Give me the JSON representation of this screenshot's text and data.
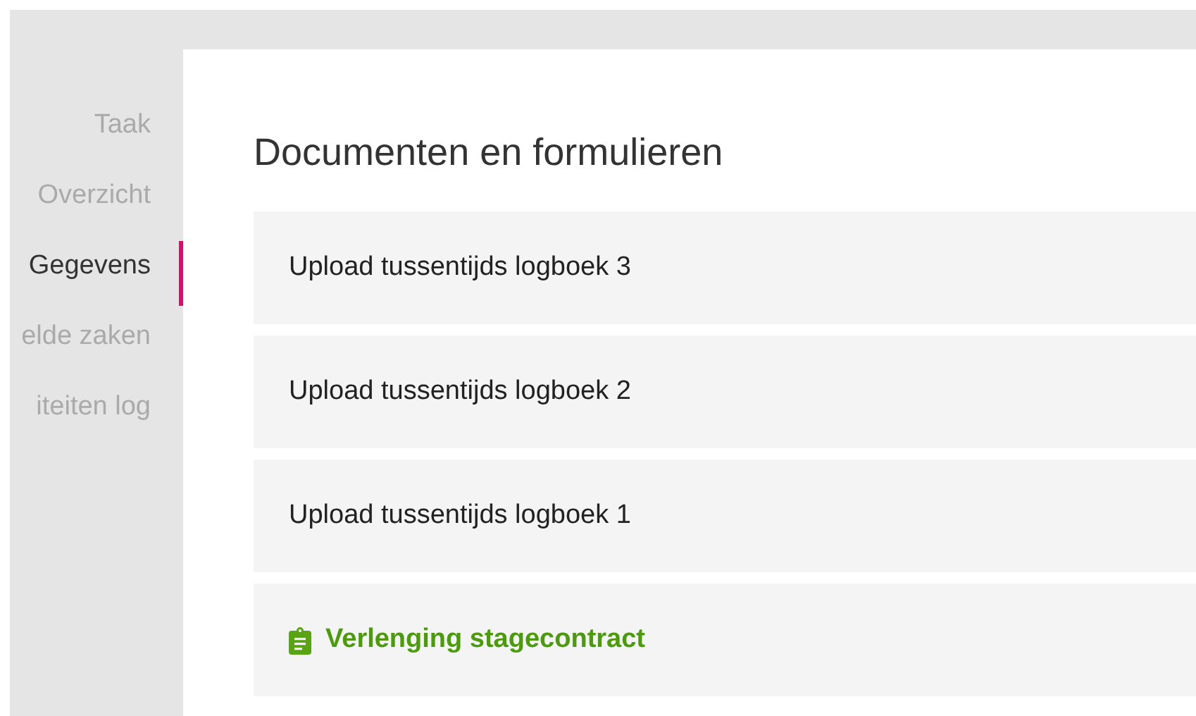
{
  "sidebar": {
    "items": [
      {
        "label": "Taak",
        "selected": false
      },
      {
        "label": "Overzicht",
        "selected": false
      },
      {
        "label": "Gegevens",
        "selected": true
      },
      {
        "label": "elde zaken",
        "selected": false
      },
      {
        "label": "iteiten log",
        "selected": false
      }
    ]
  },
  "main": {
    "title": "Documenten en formulieren",
    "documents": [
      {
        "kind": "upload",
        "label": "Upload tussentijds logboek 3"
      },
      {
        "kind": "upload",
        "label": "Upload tussentijds logboek 2"
      },
      {
        "kind": "upload",
        "label": "Upload tussentijds logboek 1"
      },
      {
        "kind": "form",
        "label": "Verlenging stagecontract"
      }
    ]
  }
}
